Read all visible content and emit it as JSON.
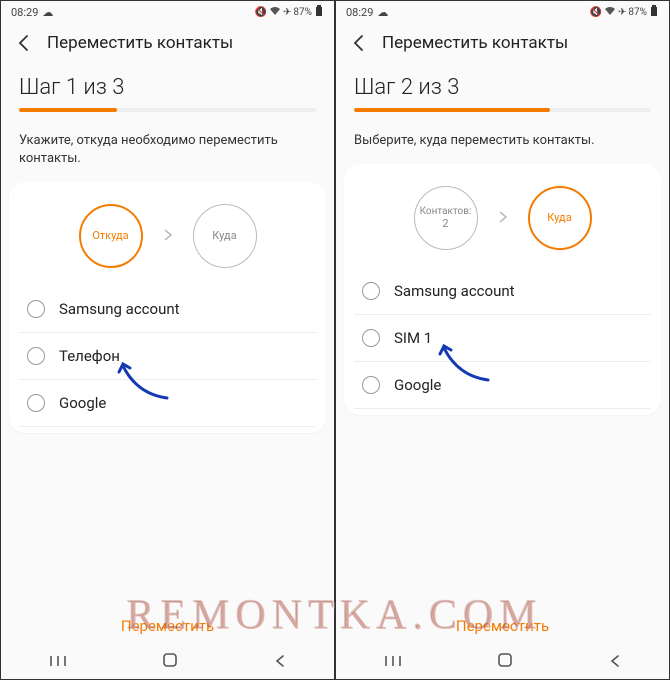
{
  "status": {
    "time": "08:29",
    "battery": "87%"
  },
  "left": {
    "title": "Переместить контакты",
    "step": "Шаг 1 из 3",
    "progress_pct": 33,
    "instruction": "Укажите, откуда необходимо переместить контакты.",
    "circle_from": "Откуда",
    "circle_to": "Куда",
    "options": [
      "Samsung account",
      "Телефон",
      "Google"
    ],
    "action": "Переместить"
  },
  "right": {
    "title": "Переместить контакты",
    "step": "Шаг 2 из 3",
    "progress_pct": 66,
    "instruction": "Выберите, куда переместить контакты.",
    "circle_from_line1": "Контактов:",
    "circle_from_line2": "2",
    "circle_to": "Куда",
    "options": [
      "Samsung account",
      "SIM 1",
      "Google"
    ],
    "action": "Переместить"
  },
  "watermark": "REMONTKA.COM"
}
